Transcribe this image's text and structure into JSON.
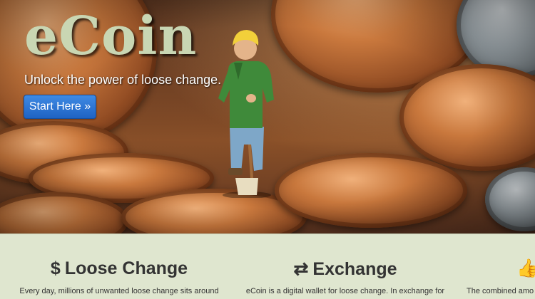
{
  "hero": {
    "brand": "eCoin",
    "tagline": "Unlock the power of loose change.",
    "cta_label": "Start Here »"
  },
  "features": [
    {
      "icon": "dollar-icon",
      "icon_glyph": "$",
      "title": "Loose Change",
      "text": "Every day, millions of unwanted loose change sits around"
    },
    {
      "icon": "exchange-arrows-icon",
      "icon_glyph": "⇄",
      "title": "Exchange",
      "text": "eCoin is a digital wallet for loose change. In exchange for"
    },
    {
      "icon": "thumbs-up-icon",
      "icon_glyph": "👍",
      "title": "",
      "text": "The combined amo"
    }
  ],
  "colors": {
    "brand_text": "#c9d6b3",
    "cta_blue": "#2a74d4",
    "features_bg": "#dfe6cf"
  }
}
